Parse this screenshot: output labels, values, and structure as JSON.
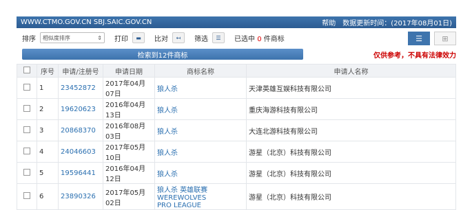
{
  "header": {
    "site": "WWW.CTMO.GOV.CN SBJ.SAIC.GOV.CN",
    "help": "帮助",
    "updated": "数据更新时间：(2017年08月01日)"
  },
  "toolbar": {
    "sort_label": "排序",
    "sort_value": "相似度排序",
    "print_label": "打印",
    "compare_label": "比对",
    "filter_label": "筛选",
    "selected_prefix": "已选中",
    "selected_count": "0",
    "selected_suffix": "件商标"
  },
  "result_bar": "检索到12件商标",
  "disclaimer": "仅供参考，不具有法律效力",
  "table": {
    "headers": [
      "序号",
      "申请/注册号",
      "申请日期",
      "商标名称",
      "申请人名称"
    ],
    "rows": [
      {
        "no": "1",
        "reg": "23452872",
        "date": "2017年04月07日",
        "mark": "狼人杀",
        "mark2": "",
        "applicant": "天津英雄互娱科技有限公司"
      },
      {
        "no": "2",
        "reg": "19620623",
        "date": "2016年04月13日",
        "mark": "狼人杀",
        "mark2": "",
        "applicant": "重庆海游科技有限公司"
      },
      {
        "no": "3",
        "reg": "20868370",
        "date": "2016年08月03日",
        "mark": "狼人杀",
        "mark2": "",
        "applicant": "大连北游科技有限公司"
      },
      {
        "no": "4",
        "reg": "24046603",
        "date": "2017年05月10日",
        "mark": "狼人杀",
        "mark2": "",
        "applicant": "游星（北京）科技有限公司"
      },
      {
        "no": "5",
        "reg": "19596441",
        "date": "2016年04月12日",
        "mark": "狼人杀",
        "mark2": "",
        "applicant": "游星（北京）科技有限公司"
      },
      {
        "no": "6",
        "reg": "23890326",
        "date": "2017年05月02日",
        "mark": "狼人杀 英雄联赛 WEREWOLVES",
        "mark2": "PRO LEAGUE",
        "applicant": "游星（北京）科技有限公司"
      }
    ]
  }
}
